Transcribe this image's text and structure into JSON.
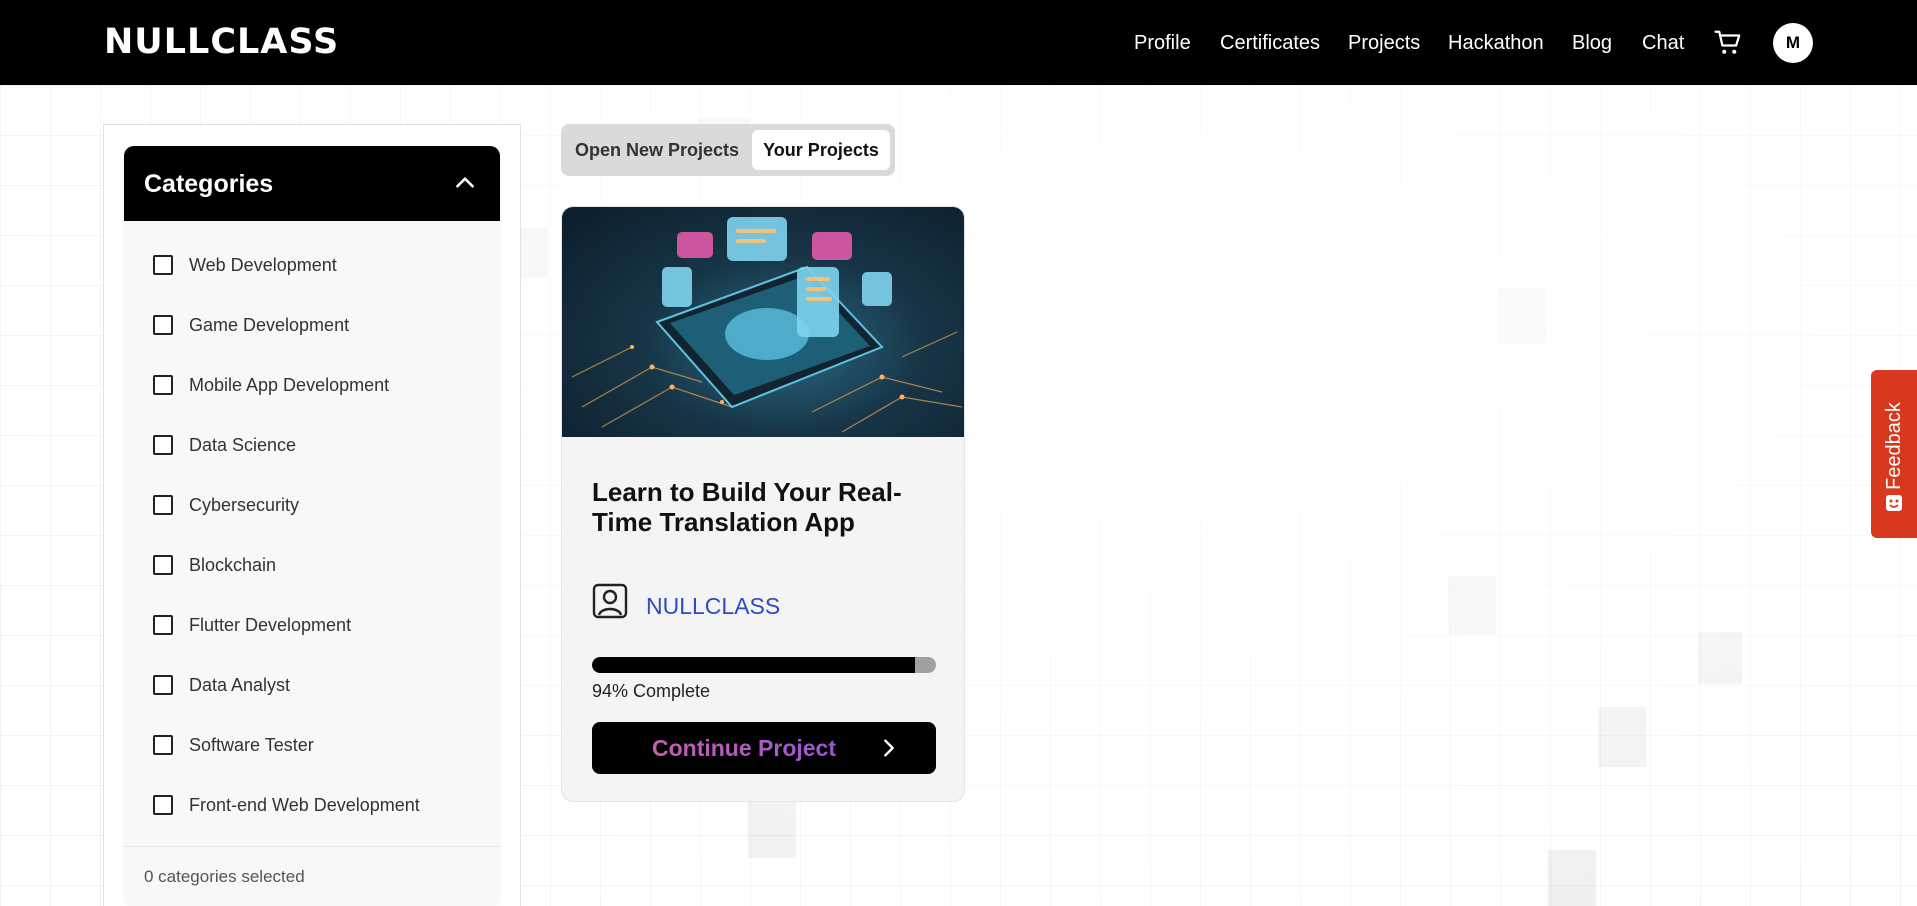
{
  "header": {
    "logo": "NULLCLASS",
    "nav": [
      "Profile",
      "Certificates",
      "Projects",
      "Hackathon",
      "Blog",
      "Chat"
    ],
    "cart_icon": "cart-icon",
    "avatar_initial": "M"
  },
  "sidebar": {
    "title": "Categories",
    "toggle_icon": "chevron-up-icon",
    "items": [
      {
        "label": "Web Development",
        "checked": false
      },
      {
        "label": "Game Development",
        "checked": false
      },
      {
        "label": "Mobile App Development",
        "checked": false
      },
      {
        "label": "Data Science",
        "checked": false
      },
      {
        "label": "Cybersecurity",
        "checked": false
      },
      {
        "label": "Blockchain",
        "checked": false
      },
      {
        "label": "Flutter Development",
        "checked": false
      },
      {
        "label": "Data Analyst",
        "checked": false
      },
      {
        "label": "Software Tester",
        "checked": false
      },
      {
        "label": "Front-end Web Development",
        "checked": false
      }
    ],
    "footer": "0 categories selected"
  },
  "tabs": [
    {
      "label": "Open New Projects",
      "active": false
    },
    {
      "label": "Your Projects",
      "active": true
    }
  ],
  "project_card": {
    "title": "Learn to Build Your Real-Time Translation App",
    "org_icon": "user-badge-icon",
    "org_name": "NULLCLASS",
    "progress_percent": 94,
    "progress_text": "94% Complete",
    "button_label": "Continue Project",
    "button_icon": "chevron-right-icon"
  },
  "feedback": {
    "label": "Feedback",
    "icon": "feedback-icon",
    "color": "#d7381e"
  },
  "colors": {
    "header_bg": "#000000",
    "org_link": "#2b4cc2",
    "button_gradient_start": "#c85fae",
    "button_gradient_end": "#9a56d6"
  }
}
